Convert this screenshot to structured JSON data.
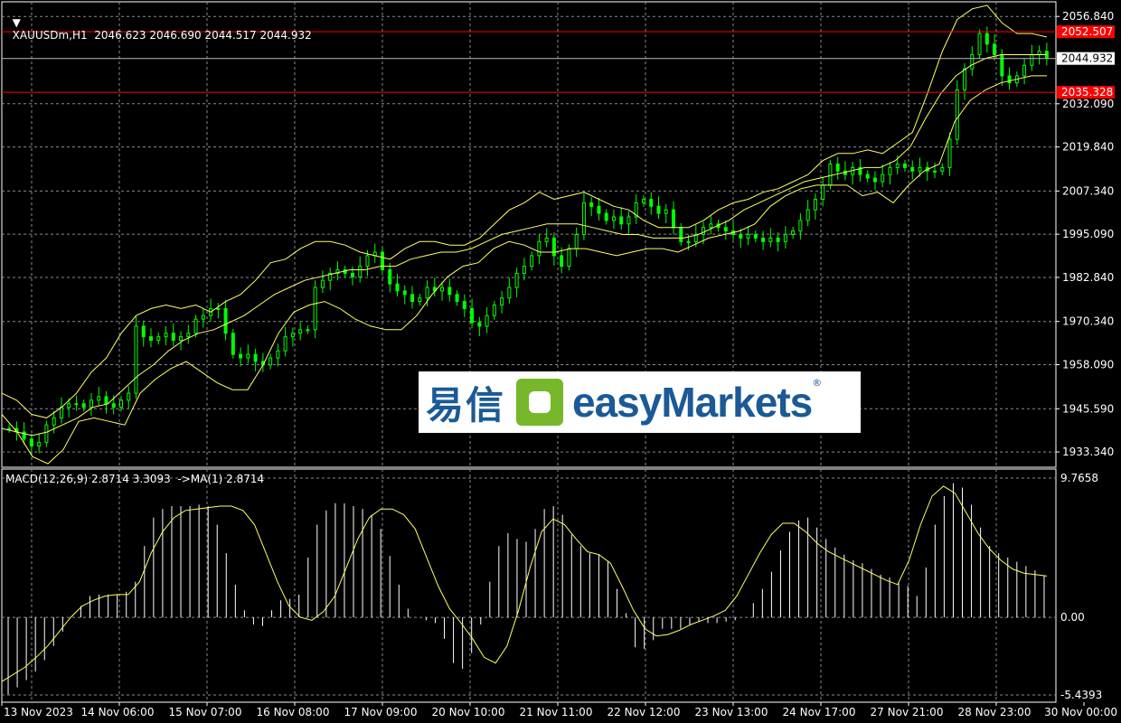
{
  "header": {
    "symbol_line": "XAUUSDm,H1  2046.623 2046.690 2044.517 2044.932",
    "macd_line": "MACD(12,26,9) 2.8714 3.3093  ->MA(1) 2.8714"
  },
  "watermark": {
    "cn": "易信",
    "en": "easyMarkets",
    "reg": "®"
  },
  "colors": {
    "background": "#000000",
    "grid": "#8a8a8a",
    "candle": "#00ff00",
    "bollinger": "#ffff66",
    "hline": "#ff0000",
    "macd_hist": "#ffffff",
    "macd_signal": "#ffff66"
  },
  "chart_data": [
    {
      "type": "candlestick",
      "title": "XAUUSDm,H1",
      "ylim": [
        1929.0,
        2061.0
      ],
      "y_ticks": [
        "2056.840",
        "2032.090",
        "2019.840",
        "2007.340",
        "1995.090",
        "1982.840",
        "1970.340",
        "1958.090",
        "1945.590",
        "1933.340"
      ],
      "x_ticks": [
        "13 Nov 2023",
        "14 Nov 06:00",
        "15 Nov 07:00",
        "16 Nov 08:00",
        "17 Nov 09:00",
        "20 Nov 10:00",
        "21 Nov 11:00",
        "22 Nov 12:00",
        "23 Nov 13:00",
        "24 Nov 17:00",
        "27 Nov 21:00",
        "28 Nov 23:00",
        "30 Nov 00:00"
      ],
      "price_labels": [
        {
          "value": 2052.507,
          "text": "2052.507",
          "style": "red"
        },
        {
          "value": 2044.932,
          "text": "2044.932",
          "style": "white"
        },
        {
          "value": 2035.328,
          "text": "2035.328",
          "style": "red"
        }
      ],
      "close_series": [
        1940,
        1939,
        1937,
        1935,
        1936,
        1941,
        1943,
        1946,
        1947,
        1947,
        1946,
        1948,
        1949,
        1947,
        1946,
        1948,
        1950,
        1969,
        1966,
        1965,
        1966,
        1967,
        1965,
        1966,
        1967,
        1971,
        1972,
        1974,
        1974,
        1967,
        1961,
        1960,
        1961,
        1959,
        1958,
        1960,
        1962,
        1966,
        1967,
        1968,
        1968,
        1980,
        1982,
        1984,
        1985,
        1984,
        1983,
        1986,
        1989,
        1990,
        1985,
        1981,
        1979,
        1978,
        1976,
        1977,
        1980,
        1979,
        1980,
        1978,
        1976,
        1974,
        1970,
        1969,
        1972,
        1975,
        1977,
        1980,
        1984,
        1986,
        1989,
        1993,
        1994,
        1989,
        1986,
        1991,
        1995,
        2004,
        2003,
        2001,
        1999,
        2000,
        1998,
        2000,
        2004,
        2005,
        2003,
        2001,
        2002,
        1997,
        1993,
        1993,
        1995,
        1997,
        1998,
        1997,
        1996,
        1995,
        1994,
        1995,
        1994,
        1993,
        1994,
        1993,
        1995,
        1996,
        1999,
        2002,
        2005,
        2009,
        2015,
        2013,
        2012,
        2014,
        2012,
        2011,
        2010,
        2012,
        2014,
        2015,
        2014,
        2013,
        2014,
        2013,
        2013,
        2014,
        2022,
        2036,
        2042,
        2046,
        2052,
        2049,
        2046,
        2040,
        2038,
        2040,
        2043,
        2046,
        2047,
        2045
      ],
      "bollinger": {
        "upper": [
          1950,
          1948,
          1944,
          1943,
          1946,
          1950,
          1956,
          1960,
          1967,
          1972,
          1974,
          1975,
          1974,
          1975,
          1973,
          1976,
          1978,
          1982,
          1987,
          1988,
          1991,
          1993,
          1993,
          1992,
          1990,
          1989,
          1988,
          1991,
          1993,
          1993,
          1992,
          1992,
          1994,
          1998,
          2002,
          2004,
          2007,
          2005,
          2006,
          2007,
          2005,
          2003,
          2002,
          1999,
          1997,
          1997,
          1997,
          1999,
          2002,
          2004,
          2005,
          2007,
          2008,
          2010,
          2012,
          2016,
          2018,
          2018,
          2019,
          2018,
          2021,
          2024,
          2035,
          2047,
          2056,
          2059,
          2060,
          2055,
          2052,
          2052,
          2051
        ],
        "middle": [
          1940,
          1939,
          1938,
          1939,
          1941,
          1943,
          1946,
          1947,
          1951,
          1955,
          1958,
          1962,
          1965,
          1967,
          1968,
          1970,
          1972,
          1975,
          1978,
          1980,
          1982,
          1983,
          1984,
          1985,
          1985,
          1986,
          1986,
          1988,
          1989,
          1990,
          1990,
          1991,
          1993,
          1995,
          1996,
          1997,
          1998,
          1998,
          1998,
          1997,
          1996,
          1995,
          1995,
          1994,
          1994,
          1994,
          1995,
          1997,
          1999,
          2002,
          2004,
          2006,
          2008,
          2010,
          2011,
          2012,
          2013,
          2014,
          2014,
          2016,
          2020,
          2028,
          2035,
          2040,
          2043,
          2045,
          2046,
          2046,
          2046,
          2046
        ],
        "lower": [
          1944,
          1939,
          1932,
          1930,
          1934,
          1942,
          1943,
          1942,
          1941,
          1950,
          1954,
          1957,
          1959,
          1956,
          1953,
          1951,
          1951,
          1958,
          1967,
          1973,
          1975,
          1976,
          1974,
          1971,
          1969,
          1968,
          1968,
          1972,
          1978,
          1983,
          1986,
          1987,
          1991,
          1993,
          1992,
          1990,
          1990,
          1991,
          1991,
          1990,
          1989,
          1990,
          1991,
          1991,
          1990,
          1992,
          1994,
          1995,
          1996,
          1998,
          2003,
          2006,
          2008,
          2009,
          2009,
          2009,
          2006,
          2007,
          2004,
          2009,
          2013,
          2015,
          2027,
          2033,
          2036,
          2038,
          2039,
          2040,
          2040
        ]
      }
    },
    {
      "type": "macd",
      "title": "MACD(12,26,9)",
      "ylim": [
        -5.4393,
        9.7658
      ],
      "y_ticks": [
        "9.7658",
        "0.00",
        "-5.4393"
      ],
      "histogram": [
        -5.4,
        -4.9,
        -4.4,
        -3.8,
        -3.0,
        -2.0,
        -1.0,
        0.0,
        0.8,
        1.5,
        1.6,
        1.6,
        1.6,
        1.8,
        2.5,
        5.0,
        7.0,
        7.6,
        7.8,
        7.8,
        7.8,
        7.9,
        7.8,
        6.5,
        4.5,
        2.3,
        0.5,
        -0.5,
        -0.6,
        0.5,
        1.2,
        1.3,
        1.6,
        4.2,
        6.5,
        7.5,
        8.0,
        8.0,
        7.8,
        7.6,
        7.2,
        6.2,
        4.3,
        2.3,
        0.6,
        0.0,
        -0.2,
        -0.4,
        -1.5,
        -3.2,
        -3.6,
        -2.5,
        -0.5,
        2.5,
        5.0,
        5.9,
        5.5,
        5.3,
        6.2,
        7.6,
        7.8,
        7.2,
        5.8,
        5.0,
        4.5,
        4.4,
        3.9,
        2.0,
        0.3,
        -2.1,
        -2.2,
        -1.6,
        -0.8,
        -0.8,
        -0.8,
        -0.5,
        -0.3,
        -0.4,
        -0.4,
        -0.3,
        -0.2,
        0.0,
        1.0,
        2.0,
        3.2,
        4.7,
        6.0,
        6.8,
        7.0,
        6.3,
        5.5,
        4.9,
        4.4,
        4.0,
        3.8,
        3.4,
        3.0,
        2.8,
        2.4,
        2.2,
        1.5,
        3.5,
        6.5,
        8.5,
        9.4,
        9.1,
        7.9,
        6.3,
        5.0,
        4.5,
        4.2,
        3.9,
        3.6,
        3.3,
        2.9
      ],
      "signal": [
        -4.5,
        -4.0,
        -3.5,
        -2.8,
        -2.0,
        -1.0,
        0.0,
        0.8,
        1.2,
        1.5,
        1.6,
        1.6,
        2.5,
        4.5,
        6.0,
        7.0,
        7.5,
        7.6,
        7.7,
        7.8,
        7.8,
        7.5,
        6.5,
        4.5,
        2.5,
        0.8,
        0.0,
        -0.2,
        0.4,
        1.5,
        3.5,
        5.5,
        7.0,
        7.6,
        7.6,
        7.2,
        6.2,
        4.2,
        2.2,
        0.6,
        -0.4,
        -1.5,
        -2.8,
        -3.2,
        -2.0,
        0.5,
        3.5,
        6.0,
        6.9,
        6.5,
        5.5,
        4.6,
        4.4,
        3.8,
        2.2,
        0.5,
        -0.8,
        -1.3,
        -1.2,
        -0.9,
        -0.5,
        -0.2,
        0.1,
        0.5,
        1.5,
        3.0,
        4.5,
        5.8,
        6.6,
        6.6,
        6.0,
        5.2,
        4.6,
        4.2,
        3.8,
        3.4,
        3.0,
        2.6,
        2.3,
        4.0,
        6.5,
        8.5,
        9.2,
        8.7,
        7.3,
        5.9,
        4.8,
        4.0,
        3.4,
        3.1,
        3.0,
        2.9
      ]
    }
  ]
}
